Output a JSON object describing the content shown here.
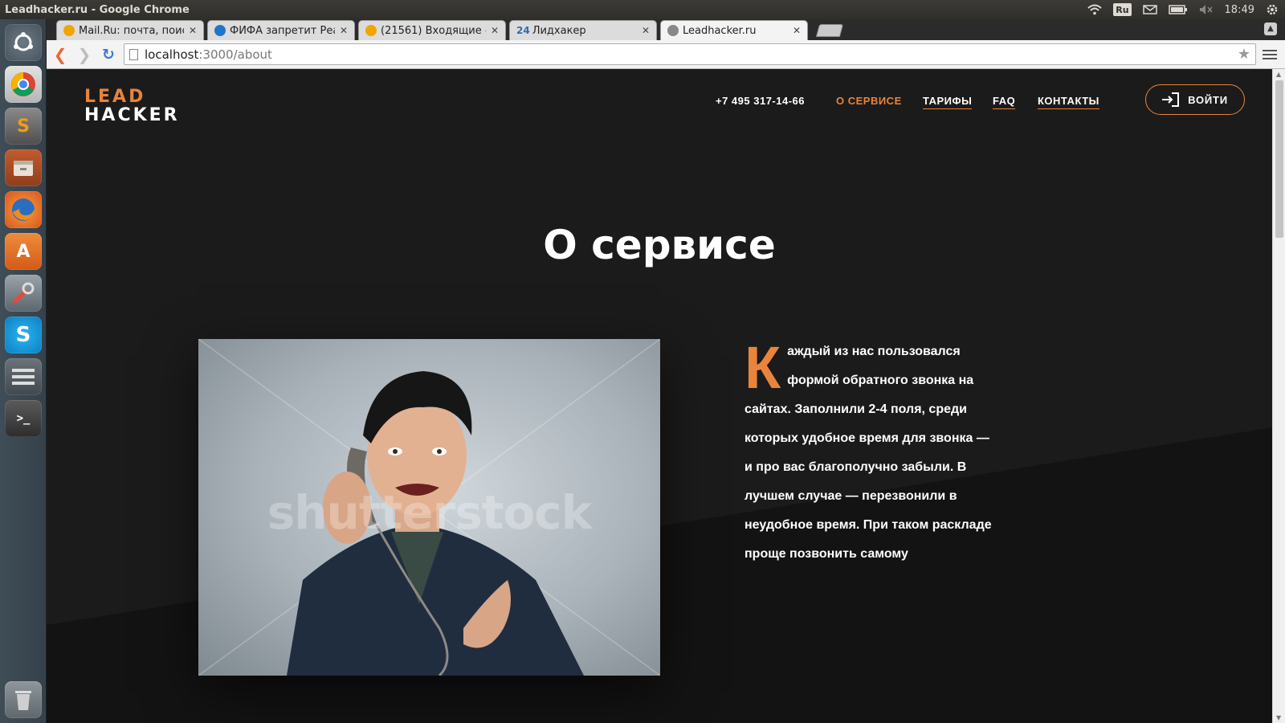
{
  "os": {
    "window_title": "Leadhacker.ru - Google Chrome",
    "indicators": {
      "lang": "Ru",
      "clock": "18:49"
    },
    "launcher": [
      {
        "name": "dash-icon"
      },
      {
        "name": "chrome-icon"
      },
      {
        "name": "sublime-text-icon",
        "glyph": "S"
      },
      {
        "name": "file-manager-icon"
      },
      {
        "name": "firefox-icon"
      },
      {
        "name": "software-center-icon",
        "glyph": "A"
      },
      {
        "name": "system-settings-icon"
      },
      {
        "name": "skype-icon",
        "glyph": "S"
      },
      {
        "name": "workspaces-icon"
      },
      {
        "name": "terminal-icon",
        "glyph": ">_"
      },
      {
        "name": "trash-icon"
      }
    ]
  },
  "browser": {
    "tabs": [
      {
        "title": "Mail.Ru: почта, поис",
        "favicon_color": "#f0a500"
      },
      {
        "title": "ФИФА запретит Реа",
        "favicon_color": "#1f76c9"
      },
      {
        "title": "(21561) Входящие -",
        "favicon_color": "#f0a500"
      },
      {
        "title": "Лидхакер",
        "favicon_text": "24",
        "favicon_color": "#2f6db5"
      },
      {
        "title": "Leadhacker.ru",
        "favicon_color": "#888888"
      }
    ],
    "url_host": "localhost",
    "url_path": ":3000/about"
  },
  "site": {
    "logo_top": "LEAD",
    "logo_bottom": "HACKER",
    "phone": "+7 495 317-14-66",
    "nav": [
      "О СЕРВИСЕ",
      "ТАРИФЫ",
      "FAQ",
      "КОНТАКТЫ"
    ],
    "login": "ВОЙТИ",
    "title": "О сервисе",
    "watermark": "shutterstock",
    "dropcap": "К",
    "paragraph": "аждый из нас пользовался формой обратного звонка на сайтах. Заполнили 2-4 поля, среди которых удобное время для звонка — и про вас благополучно забыли. В лучшем случае — перезвонили в неудобное время. При таком раскладе проще позвонить самому",
    "colors": {
      "accent": "#e8843c",
      "background": "#1b1b1b",
      "text": "#ffffff"
    }
  }
}
